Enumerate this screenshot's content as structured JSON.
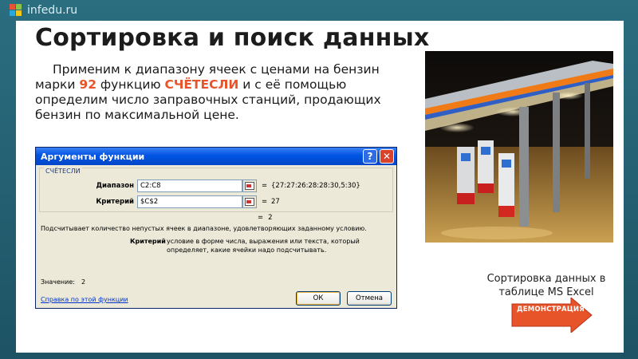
{
  "logo": {
    "text": "infedu.ru"
  },
  "slide": {
    "title": "Сортировка и поиск данных",
    "body": {
      "part1": "Применим к диапазону ячеек с ценами на бензин марки ",
      "hl1": "92",
      "part2": " функцию ",
      "hl2": "СЧЁТЕСЛИ",
      "part3": " и с её помощью определим число заправочных станций, продающих бензин по максимальной цене."
    },
    "caption": "Сортировка данных в таблице MS Excel",
    "demo_button": "ДЕМОНСТРАЦИЯ"
  },
  "dialog": {
    "title": "Аргументы функции",
    "help_btn": "?",
    "close_btn": "✕",
    "function_name": "СЧЁТЕСЛИ",
    "args": [
      {
        "label": "Диапазон",
        "value": "C2:C8",
        "result": "{27:27:26:28:28:30,5:30}"
      },
      {
        "label": "Критерий",
        "value": "$C$2",
        "result": "27"
      }
    ],
    "eq": "=",
    "result": "2",
    "description": "Подсчитывает количество непустых ячеек в диапазоне, удовлетворяющих заданному условию.",
    "criterion_label": "Критерий",
    "criterion_help": "условие в форме числа, выражения или текста, который определяет, какие ячейки надо подсчитывать.",
    "value_label": "Значение:",
    "value": "2",
    "help_link": "Справка по этой функции",
    "ok": "ОК",
    "cancel": "Отмена"
  },
  "colors": {
    "accent": "#e8542a",
    "frame": "#1f5d6e",
    "xp_title": "#0054e3"
  }
}
